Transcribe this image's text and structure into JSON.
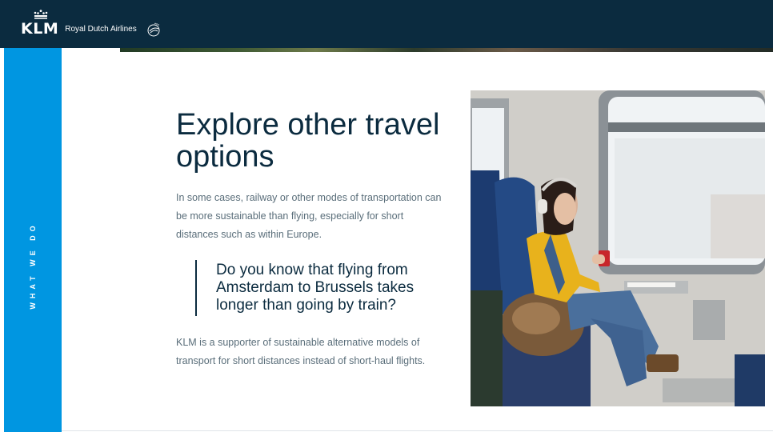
{
  "header": {
    "logo_text": "KLM",
    "logo_subtitle": "Royal Dutch Airlines"
  },
  "sidebar": {
    "section_label": "WHAT WE DO"
  },
  "main": {
    "title": "Explore other travel options",
    "intro": "In some cases, railway or other modes of transportation can be more sustainable than flying, especially for short distances such as within Europe.",
    "quote": "Do you know that flying from Amsterdam to Brussels takes longer than going by train?",
    "outro": "KLM is a supporter of sustainable alternative models of transport for short distances instead of short-haul flights."
  },
  "colors": {
    "header_bg": "#0b2b3f",
    "accent_blue": "#0096e1",
    "heading_text": "#0b2b3f",
    "body_text": "#5a6e7a"
  },
  "icons": [
    "klm-crown-icon",
    "skyteam-icon"
  ]
}
